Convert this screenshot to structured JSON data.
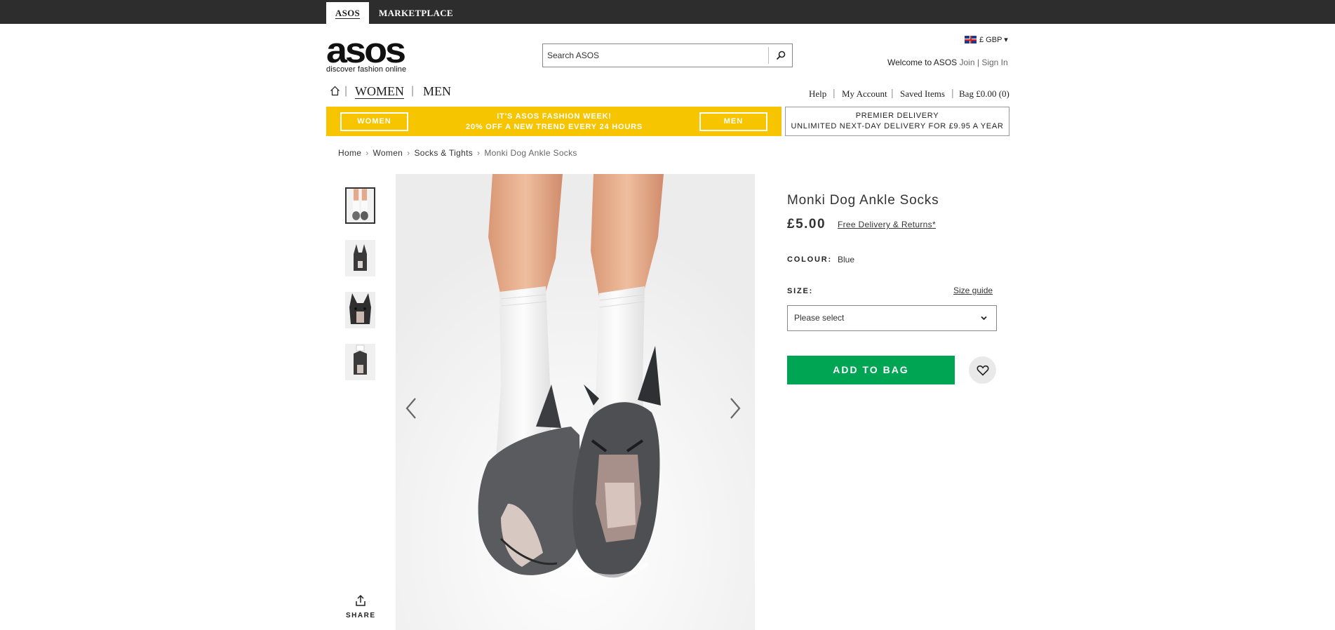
{
  "topbar": {
    "tab_asos": "ASOS",
    "tab_marketplace": "MARKETPLACE"
  },
  "logo": {
    "word": "asos",
    "tagline": "discover fashion online"
  },
  "search": {
    "placeholder": "Search ASOS"
  },
  "currency": {
    "label": "£ GBP ▾"
  },
  "account": {
    "welcome": "Welcome to ASOS",
    "join": "Join",
    "sep": "|",
    "sign_in": "Sign In"
  },
  "nav": {
    "women": "WOMEN",
    "men": "MEN"
  },
  "utility": {
    "help": "Help",
    "my_account": "My Account",
    "saved_items": "Saved Items",
    "bag": "Bag £0.00 (0)"
  },
  "promo": {
    "women": "WOMEN",
    "men": "MEN",
    "line1": "IT'S ASOS FASHION WEEK!",
    "line2": "20% OFF A NEW TREND EVERY 24 HOURS",
    "color": "#f7c500"
  },
  "premier": {
    "line1": "PREMIER DELIVERY",
    "line2": "UNLIMITED NEXT-DAY DELIVERY FOR £9.95 A YEAR"
  },
  "breadcrumb": {
    "home": "Home",
    "women": "Women",
    "category": "Socks & Tights",
    "current": "Monki Dog Ankle Socks",
    "sep": "›"
  },
  "share": {
    "label": "SHARE"
  },
  "product": {
    "title": "Monki Dog Ankle Socks",
    "price": "£5.00",
    "delivery": "Free Delivery & Returns*",
    "colour_label": "COLOUR:",
    "colour_value": "Blue",
    "size_label": "SIZE:",
    "size_guide": "Size guide",
    "size_placeholder": "Please select",
    "add_to_bag": "ADD TO BAG",
    "add_color": "#00a554"
  }
}
